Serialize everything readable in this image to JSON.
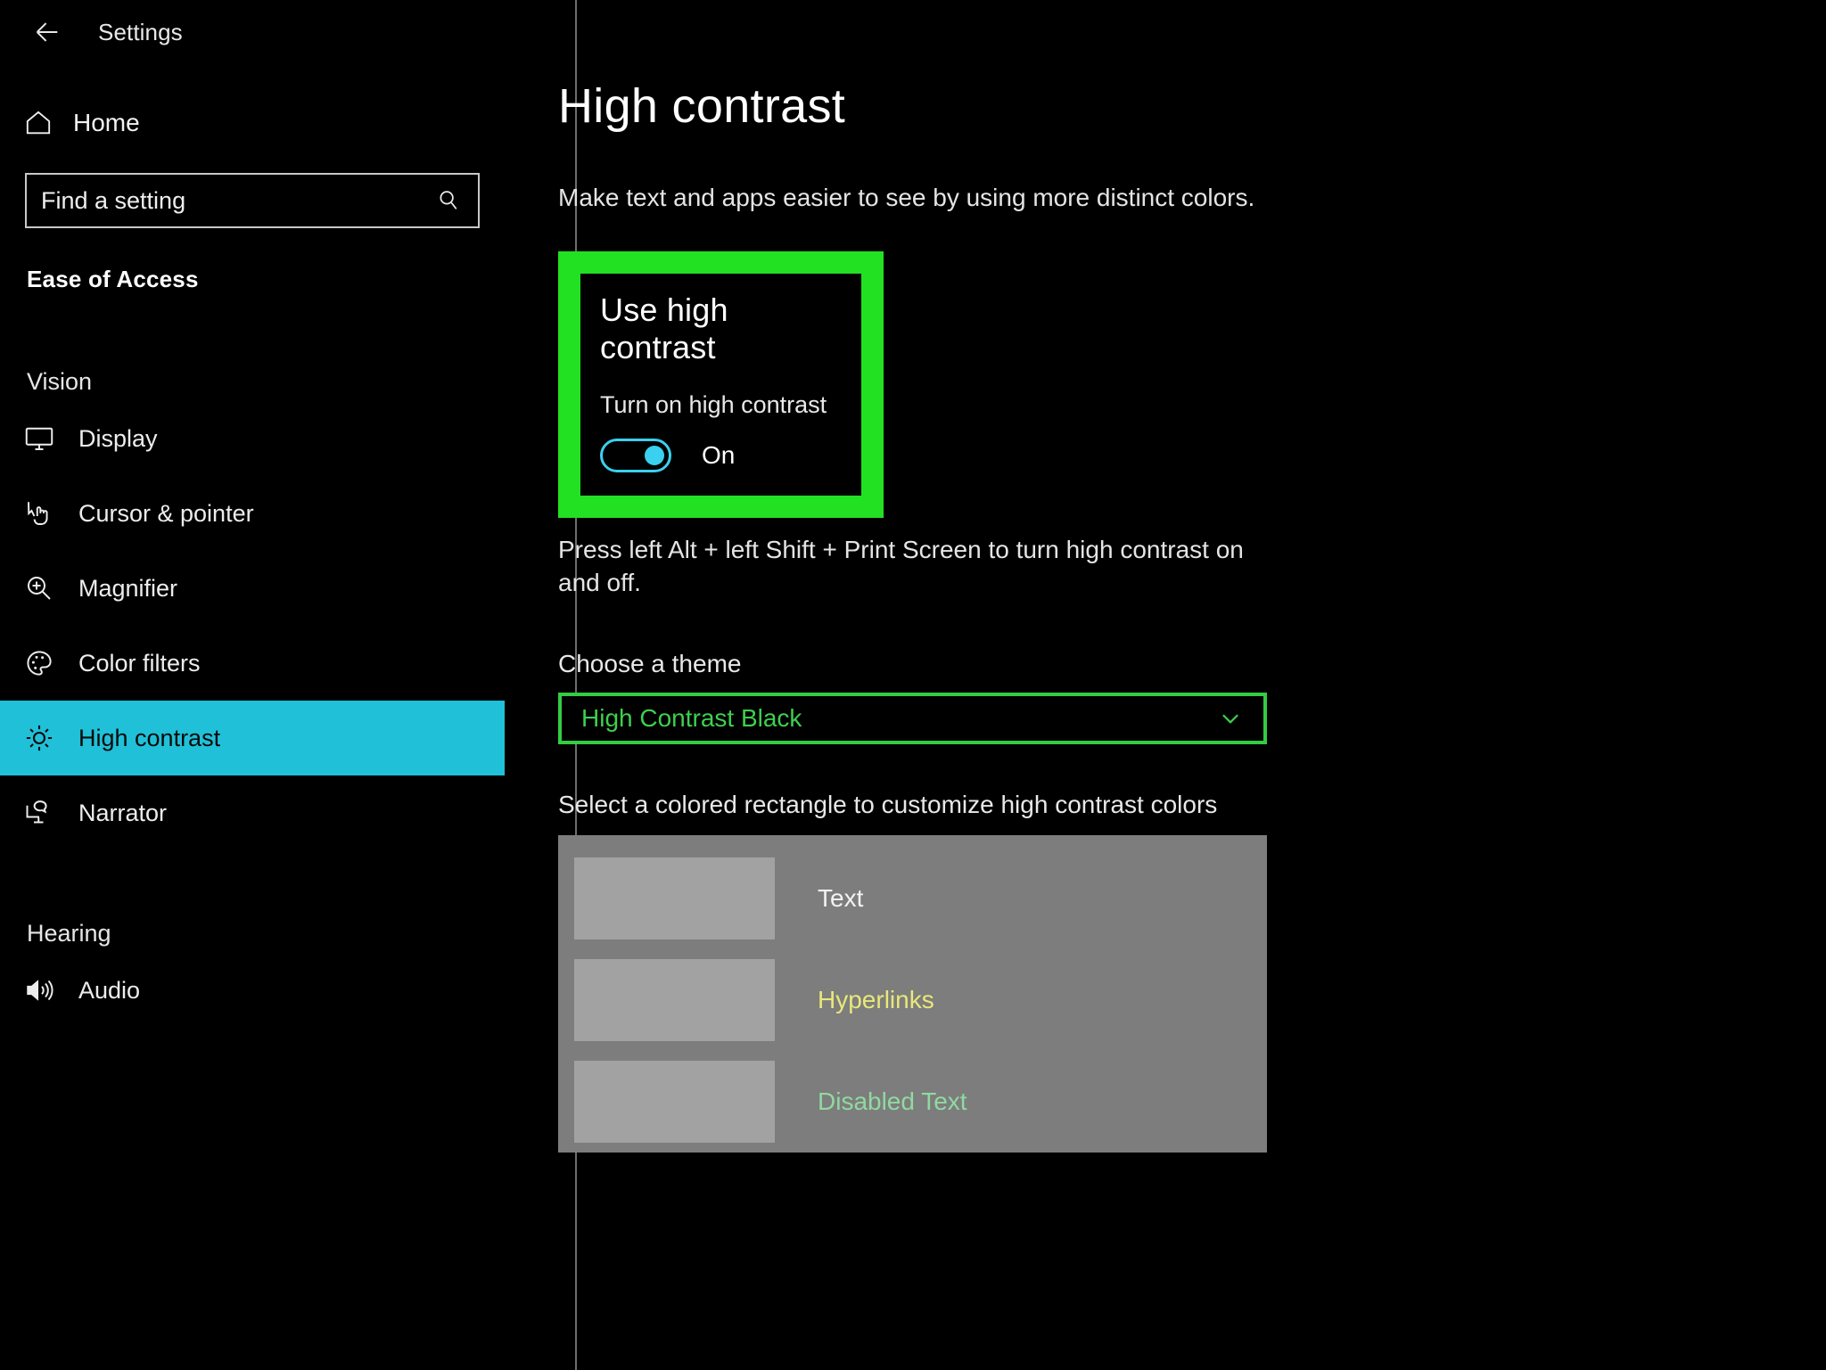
{
  "sidebar": {
    "back_icon": "back-arrow-icon",
    "title": "Settings",
    "home": {
      "label": "Home",
      "icon": "home-icon"
    },
    "search": {
      "placeholder": "Find a setting",
      "value": "",
      "icon": "search-icon"
    },
    "section_title": "Ease of Access",
    "groups": [
      {
        "label": "Vision",
        "items": [
          {
            "label": "Display",
            "icon": "monitor-icon",
            "active": false
          },
          {
            "label": "Cursor & pointer",
            "icon": "cursor-pointer-icon",
            "active": false
          },
          {
            "label": "Magnifier",
            "icon": "magnifier-icon",
            "active": false
          },
          {
            "label": "Color filters",
            "icon": "palette-icon",
            "active": false
          },
          {
            "label": "High contrast",
            "icon": "brightness-icon",
            "active": true
          },
          {
            "label": "Narrator",
            "icon": "narrator-icon",
            "active": false
          }
        ]
      },
      {
        "label": "Hearing",
        "items": [
          {
            "label": "Audio",
            "icon": "speaker-icon",
            "active": false
          }
        ]
      }
    ],
    "active_item_color": "#20c0d8"
  },
  "main": {
    "page_title": "High contrast",
    "description": "Make text and apps easier to see by using more distinct colors.",
    "highlight": {
      "border_color": "#22e022",
      "heading": "Use high contrast",
      "toggle_label": "Turn on high contrast",
      "toggle_state": "On",
      "toggle_color": "#3ad0ef"
    },
    "shortcut_text": "Press left Alt + left Shift + Print Screen to turn high contrast on and off.",
    "theme": {
      "label": "Choose a theme",
      "selected": "High Contrast Black",
      "border_color": "#33cc44",
      "text_color": "#3ecf4e",
      "chevron_icon": "chevron-down-icon"
    },
    "colors": {
      "hint": "Select a colored rectangle to customize high contrast colors",
      "panel_bg": "#7d7d7d",
      "swatch_bg": "#a2a2a2",
      "rows": [
        {
          "name": "Text",
          "color": "#f2f2f2"
        },
        {
          "name": "Hyperlinks",
          "color": "#e8e87a"
        },
        {
          "name": "Disabled Text",
          "color": "#90d9a0"
        }
      ]
    }
  }
}
